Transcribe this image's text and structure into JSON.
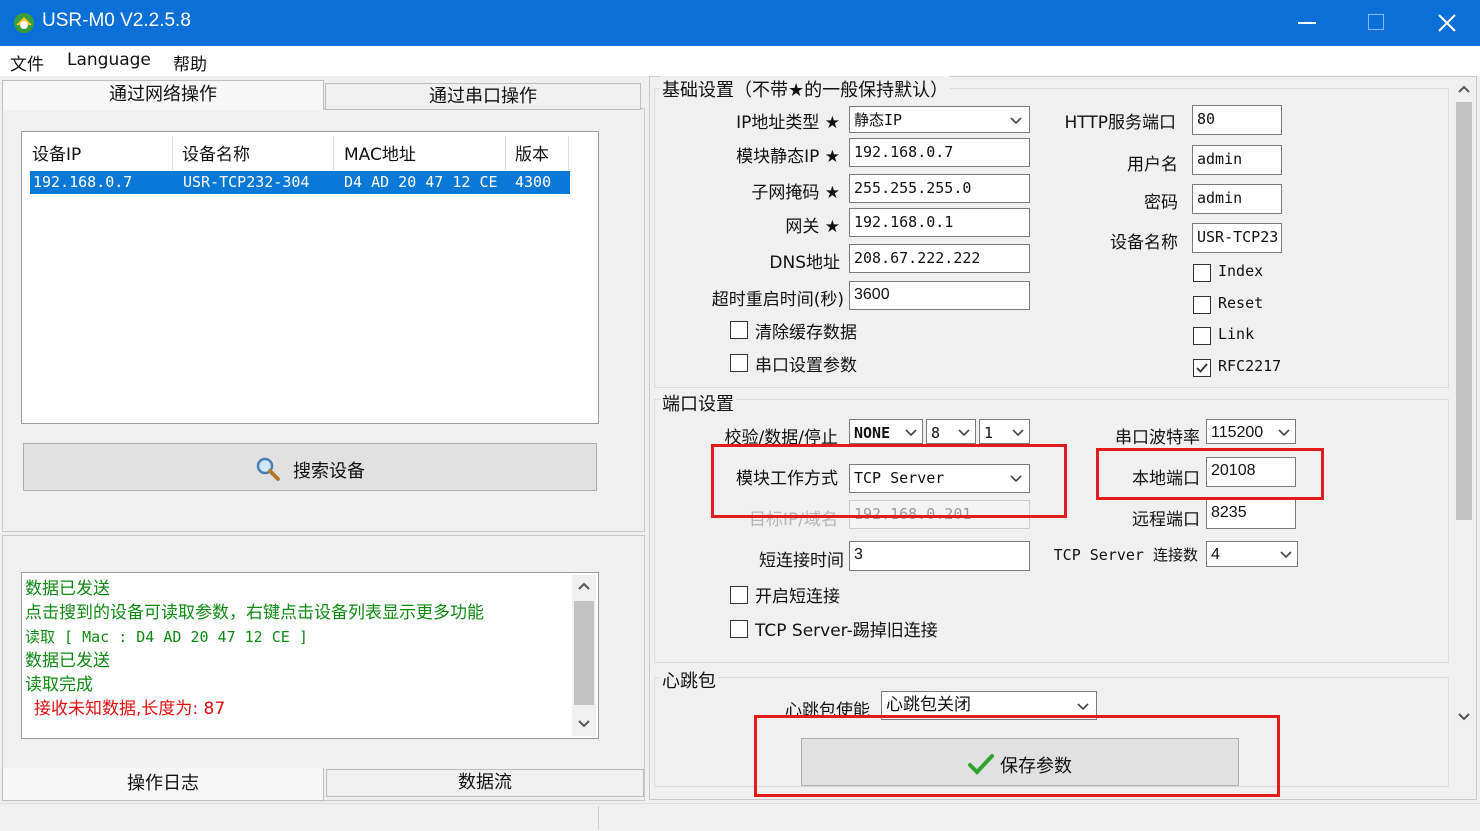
{
  "window": {
    "title": "USR-M0 V2.2.5.8"
  },
  "menu": [
    "文件",
    "Language",
    "帮助"
  ],
  "left_tabs": [
    "通过网络操作",
    "通过串口操作"
  ],
  "device_table": {
    "headers": [
      "设备IP",
      "设备名称",
      "MAC地址",
      "版本"
    ],
    "rows": [
      [
        "192.168.0.7",
        "USR-TCP232-304",
        "D4 AD 20 47 12 CE",
        "4300"
      ]
    ]
  },
  "search_button": "搜索设备",
  "log_lines": [
    "数据已发送",
    "点击搜到的设备可读取参数，右键点击设备列表显示更多功能",
    "读取 [ Mac : D4 AD 20 47 12 CE ]",
    "数据已发送",
    "读取完成"
  ],
  "log_error": "接收未知数据,长度为: 87",
  "bottom_tabs": [
    "操作日志",
    "数据流"
  ],
  "basic": {
    "group": "基础设置（不带★的一般保持默认）",
    "ip_type_label": "IP地址类型 ★",
    "ip_type": "静态IP",
    "static_ip_label": "模块静态IP ★",
    "static_ip": "192.168.0.7",
    "mask_label": "子网掩码 ★",
    "mask": "255.255.255.0",
    "gateway_label": "网关 ★",
    "gateway": "192.168.0.1",
    "dns_label": "DNS地址",
    "dns": "208.67.222.222",
    "timeout_label": "超时重启时间(秒)",
    "timeout": "3600",
    "clear_cache": "清除缓存数据",
    "serial_params": "串口设置参数",
    "http_port_label": "HTTP服务端口",
    "http_port": "80",
    "user_label": "用户名",
    "user": "admin",
    "pwd_label": "密码",
    "pwd": "admin",
    "devname_label": "设备名称",
    "devname": "USR-TCP23",
    "index": "Index",
    "reset": "Reset",
    "link": "Link",
    "rfc": "RFC2217"
  },
  "port": {
    "group": "端口设置",
    "parity_label": "校验/数据/停止",
    "parity": "NONE",
    "databits": "8",
    "stopbits": "1",
    "baud_label": "串口波特率",
    "baud": "115200",
    "mode_label": "模块工作方式",
    "mode": "TCP Server",
    "local_port_label": "本地端口",
    "local_port": "20108",
    "target_label": "目标IP/域名",
    "target": "192.168.0.201",
    "remote_port_label": "远程端口",
    "remote_port": "8235",
    "short_label": "短连接时间",
    "short": "3",
    "conn_label": "TCP Server 连接数",
    "conn": "4",
    "enable_short": "开启短连接",
    "kick": "TCP Server-踢掉旧连接"
  },
  "heartbeat": {
    "group": "心跳包",
    "enable_label": "心跳包使能",
    "enable": "心跳包关闭"
  },
  "save_button": "保存参数"
}
